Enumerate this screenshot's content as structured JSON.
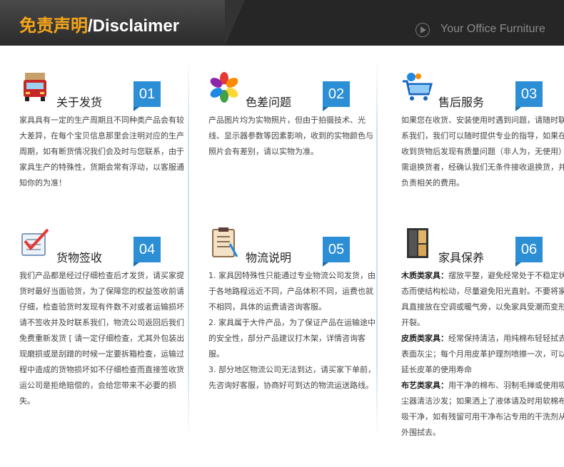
{
  "header": {
    "title_cn": "免责声明",
    "title_en": "/Disclaimer",
    "slogan": "Your Office Furniture"
  },
  "cards": [
    {
      "title": "关于发货",
      "num": "01",
      "icon": "delivery-truck-icon",
      "text": "家具具有一定的生产周期且不同种类产品会有较大差异，在每个宝贝信息那里会注明对应的生产周期，如有断货情况我们会及时与您联系，由于家具生产的特殊性，货期会常有浮动，以客服通知你的为准！"
    },
    {
      "title": "色差问题",
      "num": "02",
      "icon": "color-wheel-icon",
      "text": "产品图片均为实物照片，但由于拍摄技术、光线、显示器参数等因素影响，收到的实物颜色与照片会有差别，请以实物为准。"
    },
    {
      "title": "售后服务",
      "num": "03",
      "icon": "shopping-cart-icon",
      "text": "如果您在收货、安装使用时遇到问题，请随时联系我们，我们可以随时提供专业的指导，如果在收到货物后发现有质量问题（非人为，无使用）需退换货者，经确认我们无条件接收退换货，并负责相关的费用。"
    },
    {
      "title": "货物签收",
      "num": "04",
      "icon": "checklist-icon",
      "text": "我们产品都是经过仔细检查后才发货，请买家提货时最好当面验货，为了保障您的权益签收前请仔细，检查验货时发现有件数不对或者运输损坏请不签收并及时联系我们，物流公司返回后我们免费重新发货 [ 请一定仔细检查，尤其外包装出现磨损或是刮蹭的时候一定要拆箱检查，运输过程中造成的货物损坏如不仔细检查而直接签收货运公司是拒绝赔偿的，会给您带来不必要的损失。"
    },
    {
      "title": "物流说明",
      "num": "05",
      "icon": "clipboard-icon",
      "items": [
        "1. 家具因特殊性只能通过专业物流公司发货，由于各地路程远近不同，产品体积不同，运费也就不相同，具体的运费请咨询客服。",
        "2. 家具属于大件产品，为了保证产品在运输途中的安全性，部分产品建议打木架，详情咨询客服。",
        "3. 部分地区物流公司无法到达，请买家下单前，先咨询好客服，协商好可到达的物流运送路线。"
      ]
    },
    {
      "title": "家具保养",
      "num": "06",
      "icon": "cabinet-icon",
      "care": [
        {
          "label": "木质类家具：",
          "text": "摆放平整，避免经常处于不稳定状态而使结构松动，尽量避免阳光直射。不要将家具直接放在空调或暖气旁，以免家具受潮而变形开裂。"
        },
        {
          "label": "皮质类家具：",
          "text": "经常保持清洁，用纯棉布轻轻拭去表面灰尘；每个月用皮革护理剂喷擦一次，可以延长皮革的使用寿命"
        },
        {
          "label": "布艺类家具：",
          "text": "用干净的棉布、羽制毛掸或使用吸尘器清洁沙发；如果洒上了液体请及时用软棉布吸干净，如有残留可用干净布沾专用的干洗剂从外围拭去。"
        }
      ]
    }
  ],
  "colors": {
    "accent_orange": "#f6a61a",
    "badge_blue": "#2c8fd6",
    "header_bg": "#262626"
  }
}
